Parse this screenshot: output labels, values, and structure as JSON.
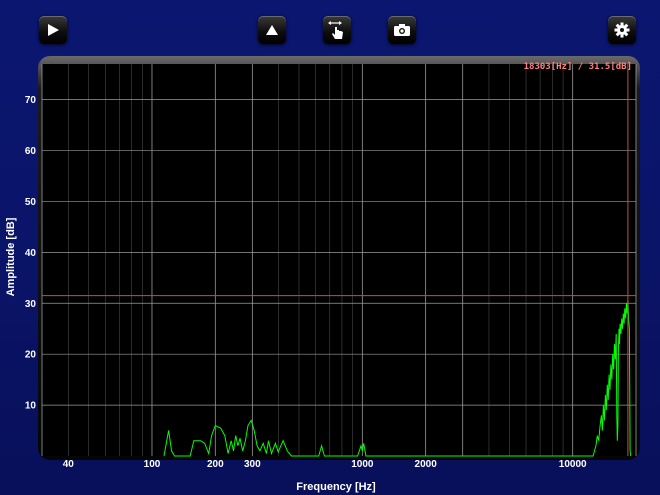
{
  "toolbar": {
    "buttons": [
      {
        "name": "play-button",
        "icon": "play-icon"
      },
      {
        "name": "scroll-up-button",
        "icon": "triangle-up-icon"
      },
      {
        "name": "pan-zoom-button",
        "icon": "hand-pointer-icon"
      },
      {
        "name": "screenshot-button",
        "icon": "camera-icon"
      },
      {
        "name": "settings-button",
        "icon": "gear-icon"
      }
    ]
  },
  "colors": {
    "background": "#0a1468",
    "plot_bg": "#000000",
    "spectrum": "#00ff00",
    "cursor": "#c0504d",
    "cursor_text": "#ff8080",
    "grid_major": "#9a9a9a",
    "grid_minor": "#4a4a4a"
  },
  "cursor": {
    "readout": "18303[Hz] / 31.5[dB]",
    "freq": 18303,
    "amp": 31.5
  },
  "chart_data": {
    "type": "line",
    "xlabel": "Frequency [Hz]",
    "ylabel": "Amplitude [dB]",
    "x_scale": "log",
    "xlim": [
      30,
      20000
    ],
    "ylim": [
      0,
      77
    ],
    "grid": true,
    "x_tick_labels": [
      {
        "value": 40,
        "label": "40"
      },
      {
        "value": 100,
        "label": "100"
      },
      {
        "value": 200,
        "label": "200"
      },
      {
        "value": 300,
        "label": "300"
      },
      {
        "value": 1000,
        "label": "1000"
      },
      {
        "value": 2000,
        "label": "2000"
      },
      {
        "value": 10000,
        "label": "10000"
      }
    ],
    "y_ticks": [
      10,
      20,
      30,
      40,
      50,
      60,
      70
    ],
    "series": [
      {
        "points": [
          [
            114,
            0
          ],
          [
            120,
            5
          ],
          [
            124,
            1
          ],
          [
            128,
            0
          ],
          [
            152,
            0
          ],
          [
            158,
            3
          ],
          [
            170,
            3
          ],
          [
            178,
            2.5
          ],
          [
            186,
            0.5
          ],
          [
            192,
            4
          ],
          [
            200,
            6
          ],
          [
            212,
            5.5
          ],
          [
            222,
            4
          ],
          [
            230,
            0.5
          ],
          [
            238,
            3
          ],
          [
            244,
            1
          ],
          [
            250,
            4
          ],
          [
            256,
            2
          ],
          [
            262,
            3.5
          ],
          [
            270,
            1
          ],
          [
            278,
            3
          ],
          [
            286,
            6
          ],
          [
            296,
            7
          ],
          [
            306,
            5
          ],
          [
            316,
            2
          ],
          [
            326,
            1
          ],
          [
            338,
            2.5
          ],
          [
            350,
            0.5
          ],
          [
            358,
            3
          ],
          [
            370,
            0.5
          ],
          [
            386,
            2.5
          ],
          [
            398,
            0.8
          ],
          [
            420,
            3
          ],
          [
            440,
            1
          ],
          [
            460,
            0
          ],
          [
            620,
            0
          ],
          [
            640,
            2
          ],
          [
            660,
            0
          ],
          [
            950,
            0
          ],
          [
            985,
            2
          ],
          [
            1000,
            1
          ],
          [
            1015,
            2.5
          ],
          [
            1040,
            0
          ],
          [
            12500,
            0
          ],
          [
            12900,
            2
          ],
          [
            13100,
            4
          ],
          [
            13300,
            3
          ],
          [
            13500,
            6
          ],
          [
            13700,
            8
          ],
          [
            13850,
            5
          ],
          [
            14000,
            10
          ],
          [
            14150,
            7
          ],
          [
            14300,
            12
          ],
          [
            14450,
            9
          ],
          [
            14600,
            14
          ],
          [
            14750,
            11
          ],
          [
            14900,
            16
          ],
          [
            15050,
            13
          ],
          [
            15200,
            18
          ],
          [
            15350,
            15
          ],
          [
            15500,
            20
          ],
          [
            15650,
            17
          ],
          [
            15800,
            22
          ],
          [
            15950,
            19
          ],
          [
            16100,
            24
          ],
          [
            16200,
            8
          ],
          [
            16300,
            3
          ],
          [
            16400,
            6
          ],
          [
            16500,
            21
          ],
          [
            16600,
            25
          ],
          [
            16700,
            22
          ],
          [
            16800,
            26
          ],
          [
            16950,
            24
          ],
          [
            17100,
            27
          ],
          [
            17250,
            25
          ],
          [
            17400,
            28
          ],
          [
            17550,
            26
          ],
          [
            17700,
            29
          ],
          [
            17850,
            27
          ],
          [
            18000,
            30
          ],
          [
            18150,
            28
          ],
          [
            18303,
            30.5
          ],
          [
            18450,
            27
          ],
          [
            18600,
            25
          ],
          [
            18750,
            1
          ],
          [
            18900,
            0
          ]
        ]
      }
    ]
  }
}
